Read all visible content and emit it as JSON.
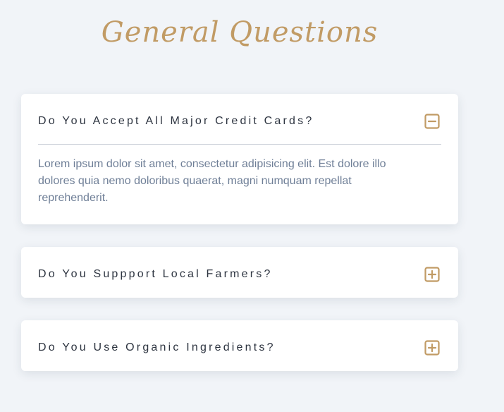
{
  "page": {
    "title": "General Questions",
    "accent_color": "#c19b65",
    "background_color": "#f1f4f8"
  },
  "faq": {
    "items": [
      {
        "question": "Do You Accept All Major Credit Cards?",
        "expanded": true,
        "toggle_icon": "minus-square-icon",
        "answer": "Lorem ipsum dolor sit amet, consectetur adipisicing elit. Est dolore illo dolores quia nemo doloribus quaerat, magni numquam repellat reprehenderit."
      },
      {
        "question": "Do You Suppport Local Farmers?",
        "expanded": false,
        "toggle_icon": "plus-square-icon"
      },
      {
        "question": "Do You Use Organic Ingredients?",
        "expanded": false,
        "toggle_icon": "plus-square-icon"
      }
    ]
  }
}
